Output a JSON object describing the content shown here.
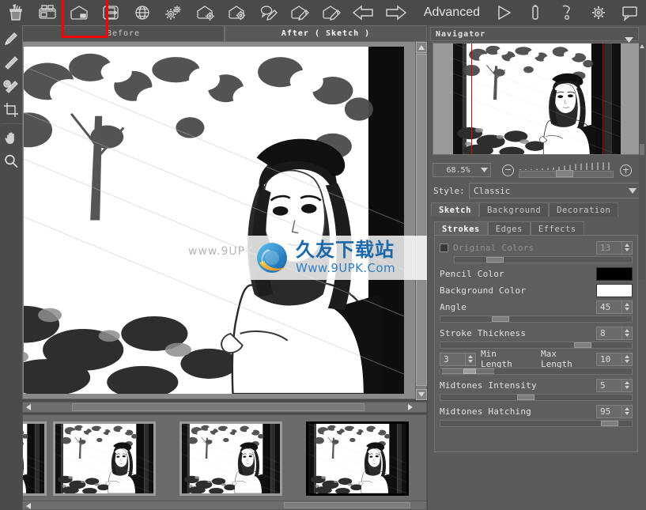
{
  "app": {
    "advanced_label": "Advanced"
  },
  "toolbar": {
    "icons": [
      {
        "name": "pencil-cup-icon",
        "label": "Tool Cup"
      },
      {
        "name": "open-folder-icon",
        "label": "Open"
      },
      {
        "name": "save-file-icon",
        "label": "Save"
      },
      {
        "name": "print-icon",
        "label": "Print"
      },
      {
        "name": "globe-icon",
        "label": "Publish"
      },
      {
        "name": "gears-icon",
        "label": "Settings"
      },
      {
        "name": "file-gear-icon",
        "label": "Batch Process"
      },
      {
        "name": "folder-gear-icon",
        "label": "Batch Folder"
      },
      {
        "name": "comment-pencil-icon",
        "label": "Annotate"
      },
      {
        "name": "file-pencil-icon",
        "label": "Edit File"
      },
      {
        "name": "folder-pencil-icon",
        "label": "Edit Folder"
      },
      {
        "name": "arrow-left-icon",
        "label": "Undo"
      },
      {
        "name": "arrow-right-icon",
        "label": "Redo"
      }
    ],
    "right_icons": [
      {
        "name": "play-icon",
        "label": "Run"
      },
      {
        "name": "battery-icon",
        "label": "Status"
      },
      {
        "name": "help-icon",
        "label": "Help"
      },
      {
        "name": "gear-icon",
        "label": "Preferences"
      },
      {
        "name": "comment-icon",
        "label": "Comments"
      }
    ]
  },
  "left_tools": [
    {
      "name": "pencil-tool",
      "label": "Pencil"
    },
    {
      "name": "eraser-tool",
      "label": "Eraser"
    },
    {
      "name": "history-brush-tool",
      "label": "History Brush"
    },
    {
      "name": "crop-tool",
      "label": "Crop"
    },
    {
      "name": "hand-tool",
      "label": "Hand"
    },
    {
      "name": "zoom-tool",
      "label": "Zoom"
    }
  ],
  "image_tabs": [
    {
      "name": "before",
      "label": "Before",
      "active": false
    },
    {
      "name": "after",
      "label": "After ( Sketch )",
      "active": true
    }
  ],
  "navigator": {
    "title": "Navigator",
    "collapse_icon": "chevron-down-icon",
    "zoom_value": "68.5%",
    "zoom_out_icon": "minus-circle-icon",
    "zoom_in_icon": "plus-circle-icon"
  },
  "style": {
    "label": "Style:",
    "value": "Classic",
    "dropdown_icon": "chevron-down-icon"
  },
  "tabs_primary": [
    {
      "name": "tab-sketch",
      "label": "Sketch",
      "active": true
    },
    {
      "name": "tab-background",
      "label": "Background",
      "active": false
    },
    {
      "name": "tab-decoration",
      "label": "Decoration",
      "active": false
    }
  ],
  "tabs_secondary": [
    {
      "name": "tab-strokes",
      "label": "Strokes",
      "active": true
    },
    {
      "name": "tab-edges",
      "label": "Edges",
      "active": false
    },
    {
      "name": "tab-effects",
      "label": "Effects",
      "active": false
    }
  ],
  "properties": {
    "original_colors": {
      "label": "Original Colors",
      "value": "13",
      "checked": false,
      "enabled": false,
      "slider_pct": 18
    },
    "pencil_color": {
      "label": "Pencil Color",
      "color": "#000000"
    },
    "background_color": {
      "label": "Background Color",
      "color": "#ffffff"
    },
    "angle": {
      "label": "Angle",
      "value": "45",
      "slider_pct": 27
    },
    "stroke_thickness": {
      "label": "Stroke Thickness",
      "value": "8",
      "slider_pct": 74
    },
    "min_length": {
      "label": "Min Length",
      "value": "3"
    },
    "max_length": {
      "label": "Max Length",
      "value": "10"
    },
    "length_range": {
      "start_pct": 2,
      "end_pct": 28,
      "knob_pct": 14
    },
    "midtones_intensity": {
      "label": "Midtones Intensity",
      "value": "5",
      "slider_pct": 43
    },
    "midtones_hatching": {
      "label": "Midtones Hatching",
      "value": "95",
      "slider_pct": 87
    }
  },
  "filmstrip": {
    "thumbnails": [
      {
        "name": "thumb-0",
        "selected": false
      },
      {
        "name": "thumb-1",
        "selected": false
      },
      {
        "name": "thumb-2",
        "selected": false
      },
      {
        "name": "thumb-3",
        "selected": true
      }
    ]
  },
  "watermark": {
    "cn_text": "久友下载站",
    "en_text": "Www.9UPK.Com",
    "ghost_text": "www.9UPK.COM",
    "brand_color": "#1b67ad"
  }
}
